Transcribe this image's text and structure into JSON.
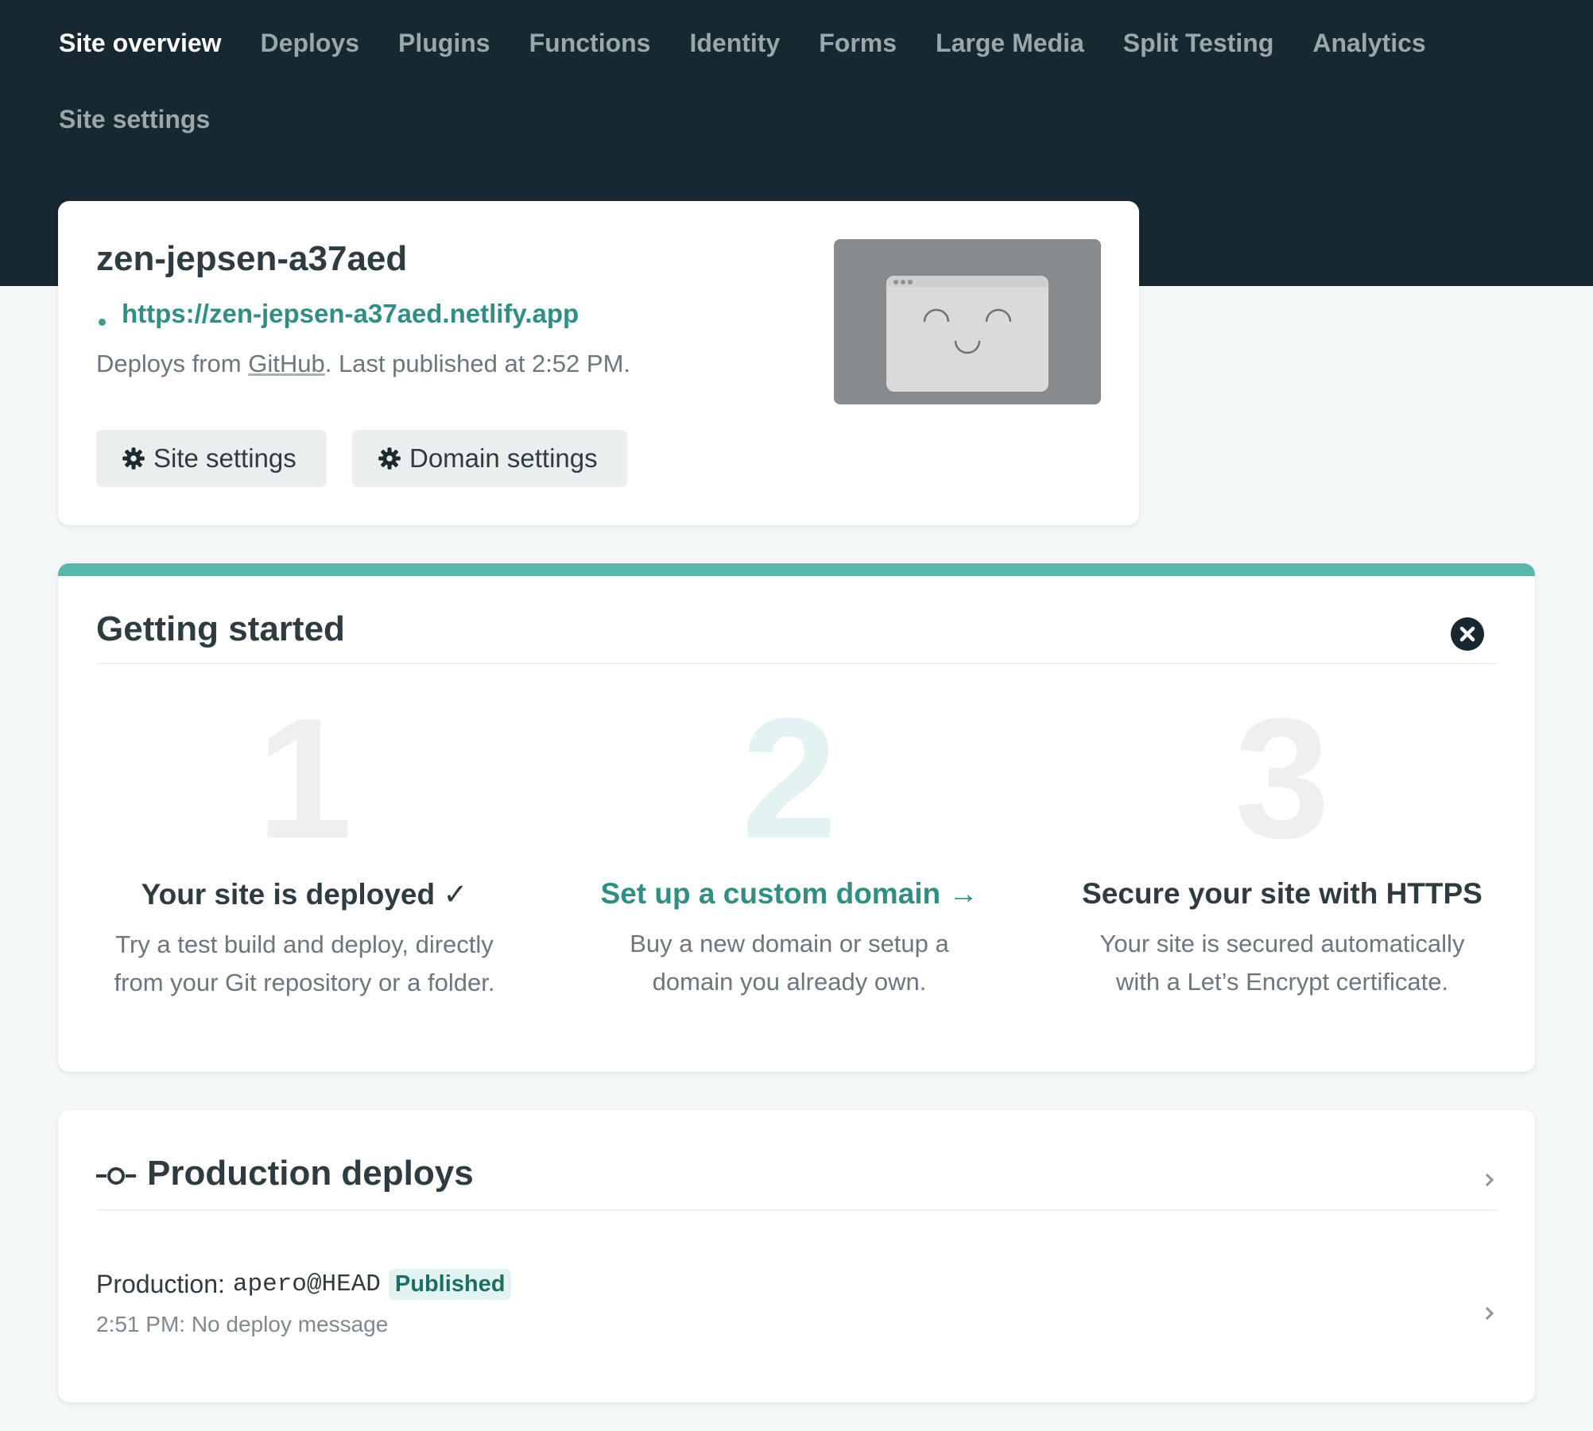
{
  "nav": {
    "items": [
      "Site overview",
      "Deploys",
      "Plugins",
      "Functions",
      "Identity",
      "Forms",
      "Large Media",
      "Split Testing",
      "Analytics"
    ],
    "second_row": [
      "Site settings"
    ],
    "active": "Site overview"
  },
  "site": {
    "name": "zen-jepsen-a37aed",
    "url": "https://zen-jepsen-a37aed.netlify.app",
    "deploy_prefix": "Deploys from ",
    "deploy_source": "GitHub",
    "deploy_suffix": ". Last published at 2:52 PM.",
    "buttons": {
      "site_settings": "Site settings",
      "domain_settings": "Domain settings"
    },
    "preview_icon": "smiley-browser-icon"
  },
  "getting_started": {
    "title": "Getting started",
    "close_icon": "close-icon",
    "steps": [
      {
        "number": "1",
        "title": "Your site is deployed ✓",
        "description_line1": "Try a test build and deploy, directly",
        "description_line2": "from your Git repository or a folder."
      },
      {
        "number": "2",
        "title": "Set up a custom domain →",
        "description_line1": "Buy a new domain or setup a",
        "description_line2": "domain you already own."
      },
      {
        "number": "3",
        "title": "Secure your site with HTTPS",
        "description_line1": "Your site is secured automatically",
        "description_line2": "with a Let’s Encrypt certificate."
      }
    ]
  },
  "production_deploys": {
    "title": "Production deploys",
    "icon": "commit-icon",
    "item": {
      "label": "Production:",
      "ref": "apero@HEAD",
      "status": "Published",
      "time_message": "2:51 PM: No deploy message"
    }
  },
  "colors": {
    "header_bg": "#172830",
    "accent": "#2f8f84",
    "accent_bar": "#5ab7ab",
    "page_bg": "#f5f8f9",
    "badge_bg": "#e2f4f1"
  }
}
